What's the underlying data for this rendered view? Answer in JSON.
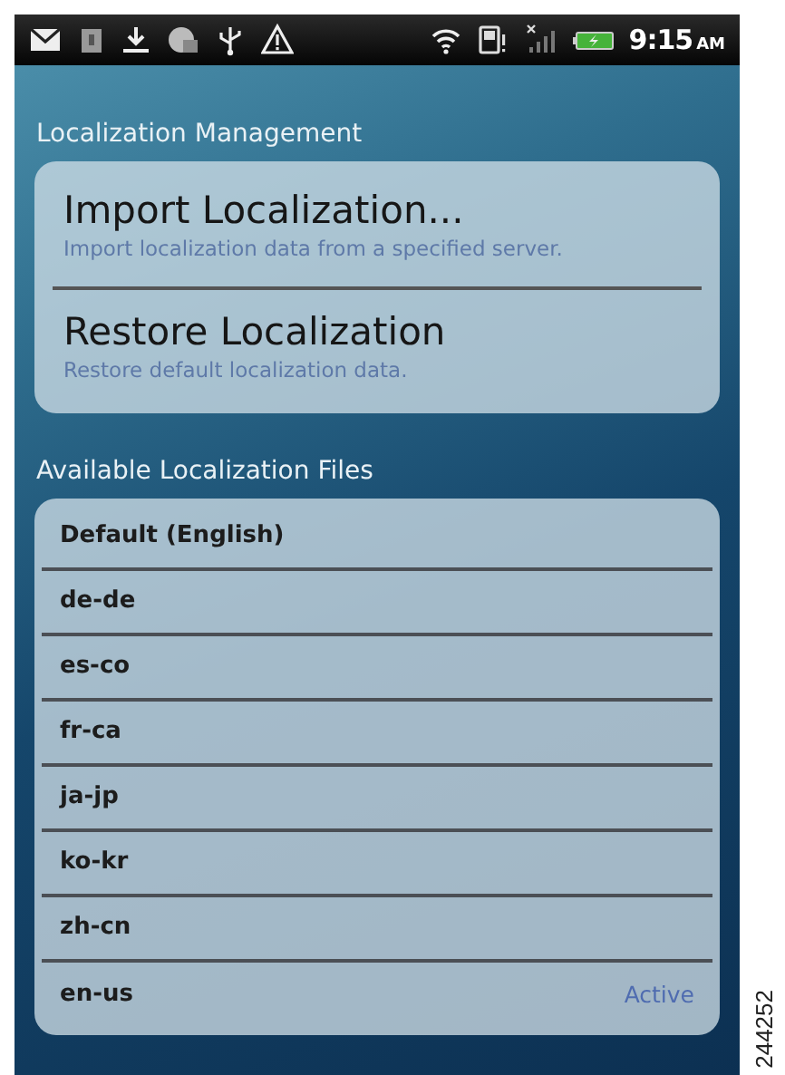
{
  "status_bar": {
    "time": "9:15",
    "meridiem": "AM"
  },
  "management": {
    "heading": "Localization Management",
    "actions": [
      {
        "title": "Import Localization...",
        "subtitle": "Import localization data from a specified server."
      },
      {
        "title": "Restore Localization",
        "subtitle": "Restore default localization data."
      }
    ]
  },
  "files": {
    "heading": "Available Localization Files",
    "items": [
      {
        "label": "Default (English)"
      },
      {
        "label": "de-de"
      },
      {
        "label": "es-co"
      },
      {
        "label": "fr-ca"
      },
      {
        "label": "ja-jp"
      },
      {
        "label": "ko-kr"
      },
      {
        "label": "zh-cn"
      },
      {
        "label": "en-us",
        "status": "Active"
      }
    ]
  },
  "figure_number": "244252"
}
